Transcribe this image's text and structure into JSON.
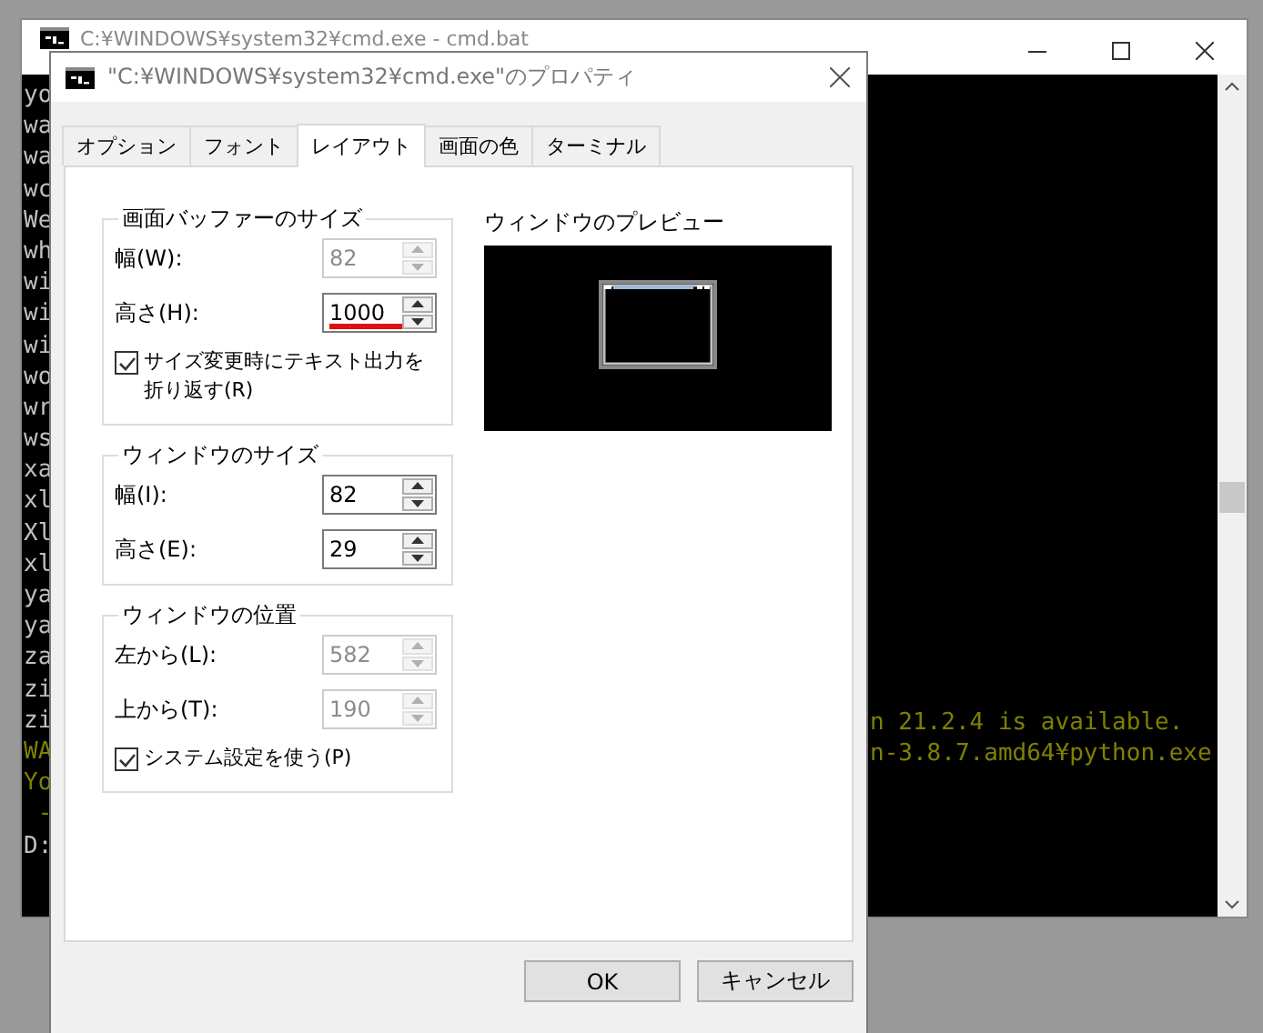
{
  "back_window": {
    "title": "C:¥WINDOWS¥system32¥cmd.exe - cmd.bat"
  },
  "console_left": [
    {
      "text": "yo",
      "color": "#c0c0c0"
    },
    {
      "text": "wa",
      "color": "#c0c0c0"
    },
    {
      "text": "wa",
      "color": "#c0c0c0"
    },
    {
      "text": "wc",
      "color": "#c0c0c0"
    },
    {
      "text": "We",
      "color": "#c0c0c0"
    },
    {
      "text": "wh",
      "color": "#c0c0c0"
    },
    {
      "text": "wi",
      "color": "#c0c0c0"
    },
    {
      "text": "wi",
      "color": "#c0c0c0"
    },
    {
      "text": "wi",
      "color": "#c0c0c0"
    },
    {
      "text": "wo",
      "color": "#c0c0c0"
    },
    {
      "text": "wr",
      "color": "#c0c0c0"
    },
    {
      "text": "ws",
      "color": "#c0c0c0"
    },
    {
      "text": "xa",
      "color": "#c0c0c0"
    },
    {
      "text": "xl",
      "color": "#c0c0c0"
    },
    {
      "text": "Xl",
      "color": "#c0c0c0"
    },
    {
      "text": "xl",
      "color": "#c0c0c0"
    },
    {
      "text": "ya",
      "color": "#c0c0c0"
    },
    {
      "text": "ya",
      "color": "#c0c0c0"
    },
    {
      "text": "za",
      "color": "#c0c0c0"
    },
    {
      "text": "zi",
      "color": "#c0c0c0"
    },
    {
      "text": "zi",
      "color": "#c0c0c0"
    },
    {
      "text": "WA",
      "color": "#808000"
    },
    {
      "text": "Yo",
      "color": "#808000"
    },
    {
      "text": " -",
      "color": "#808000"
    },
    {
      "text": "D:",
      "color": "#c0c0c0"
    }
  ],
  "console_right": [
    {
      "text": "n 21.2.4 is available.",
      "color": "#808000"
    },
    {
      "text": "n-3.8.7.amd64¥python.exe",
      "color": "#808000"
    }
  ],
  "dialog": {
    "title": "\"C:¥WINDOWS¥system32¥cmd.exe\"のプロパティ"
  },
  "tabs": [
    {
      "label": "オプション",
      "selected": false
    },
    {
      "label": "フォント",
      "selected": false
    },
    {
      "label": "レイアウト",
      "selected": true
    },
    {
      "label": "画面の色",
      "selected": false
    },
    {
      "label": "ターミナル",
      "selected": false
    }
  ],
  "groups": [
    {
      "title": "画面バッファーのサイズ",
      "fields": [
        {
          "label": "幅(W):",
          "value": "82",
          "disabled": true,
          "underlined": false
        },
        {
          "label": "高さ(H):",
          "value": "1000",
          "disabled": false,
          "underlined": true
        }
      ],
      "checkbox": {
        "label": "サイズ変更時にテキスト出力を折り返す(R)",
        "checked": true
      }
    },
    {
      "title": "ウィンドウのサイズ",
      "fields": [
        {
          "label": "幅(I):",
          "value": "82",
          "disabled": false,
          "underlined": false
        },
        {
          "label": "高さ(E):",
          "value": "29",
          "disabled": false,
          "underlined": false
        }
      ]
    },
    {
      "title": "ウィンドウの位置",
      "fields": [
        {
          "label": "左から(L):",
          "value": "582",
          "disabled": true,
          "underlined": false
        },
        {
          "label": "上から(T):",
          "value": "190",
          "disabled": true,
          "underlined": false
        }
      ],
      "checkbox": {
        "label": "システム設定を使う(P)",
        "checked": true
      }
    }
  ],
  "preview": {
    "label": "ウィンドウのプレビュー"
  },
  "buttons": [
    "OK",
    "キャンセル"
  ]
}
